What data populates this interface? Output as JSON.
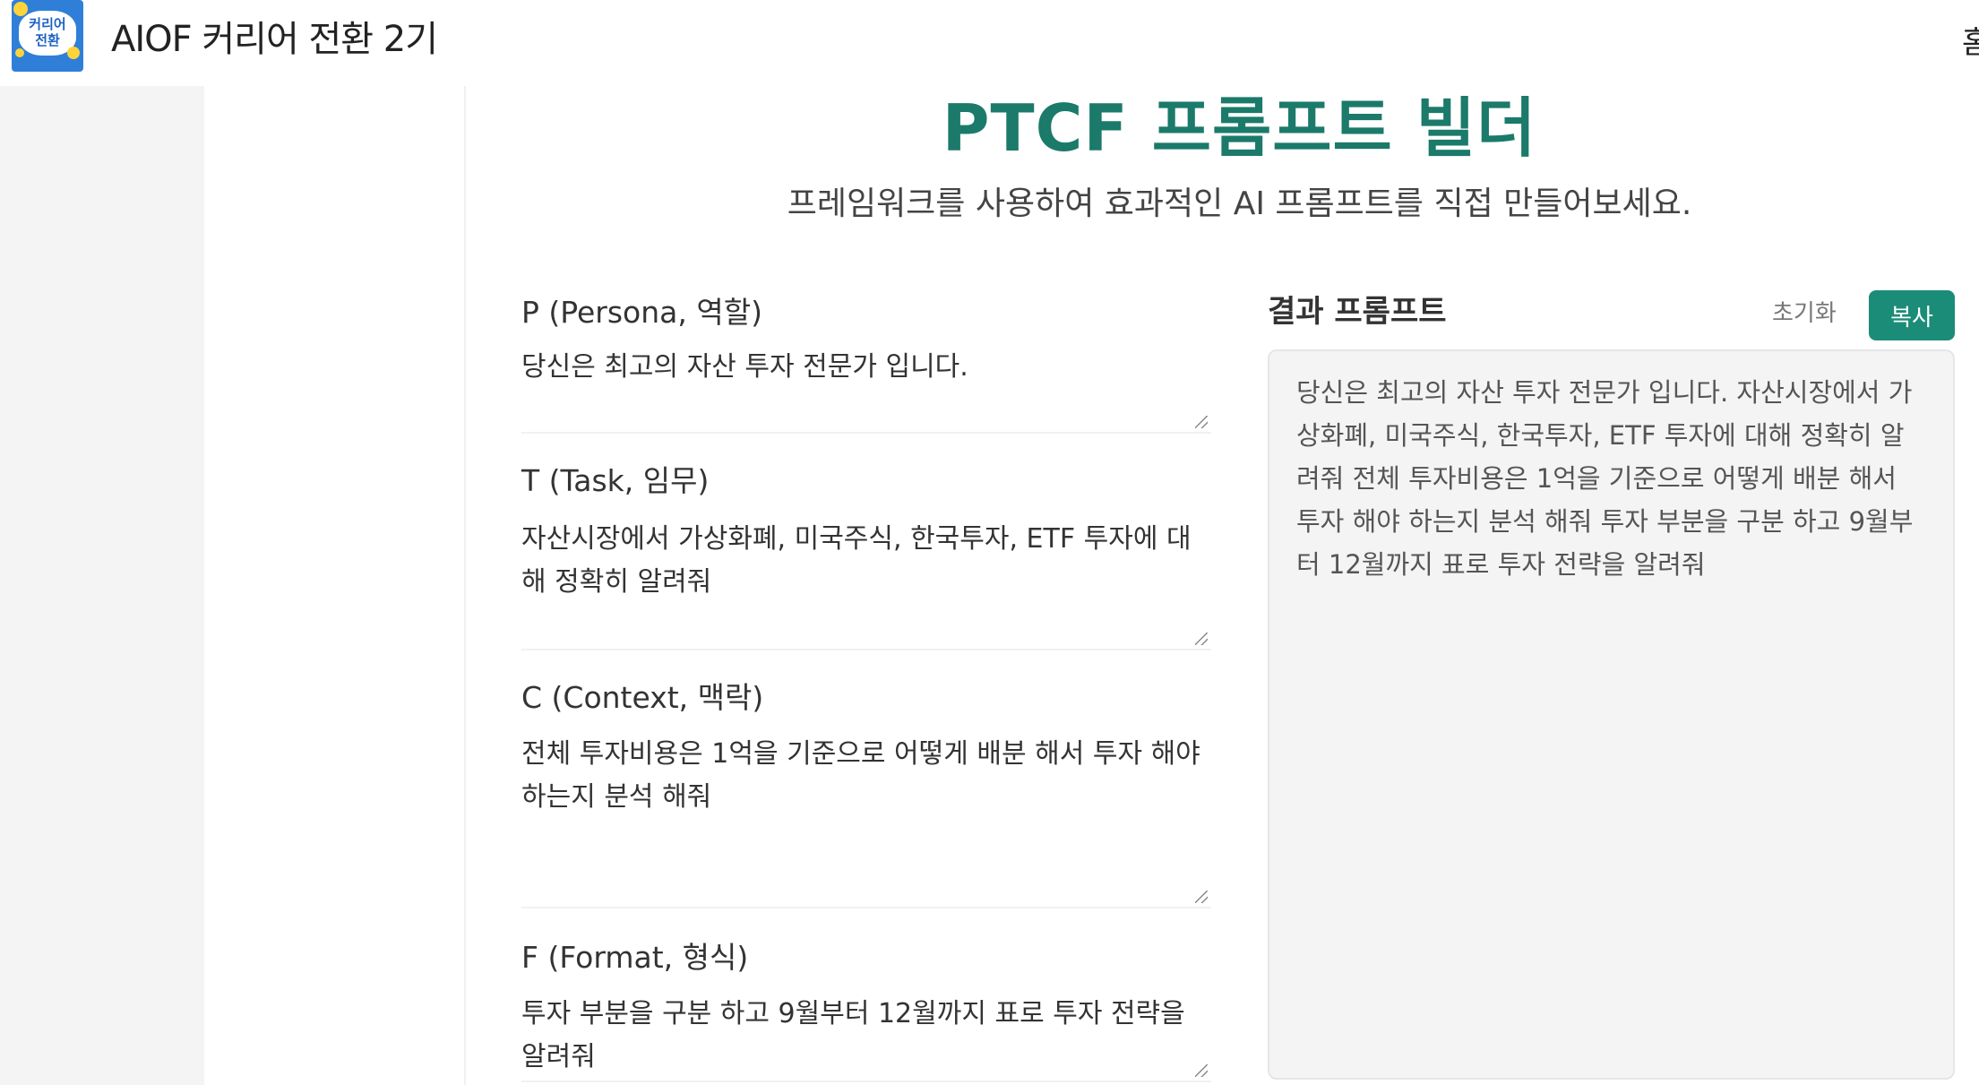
{
  "header": {
    "logo_text": "커리어\n전환",
    "site_title": "AIOF 커리어 전환 2기",
    "nav_home": "홈"
  },
  "main": {
    "title": "PTCF 프롬프트 빌더",
    "subtitle": "프레임워크를 사용하여 효과적인 AI 프롬프트를 직접 만들어보세요."
  },
  "fields": {
    "persona": {
      "label": "P (Persona, 역할)",
      "value": "당신은 최고의 자산 투자 전문가 입니다."
    },
    "task": {
      "label": "T (Task, 임무)",
      "value": "자산시장에서 가상화폐, 미국주식, 한국투자, ETF 투자에 대해 정확히 알려줘"
    },
    "context": {
      "label": "C (Context, 맥락)",
      "value": "전체 투자비용은 1억을 기준으로 어떻게 배분 해서 투자 해야 하는지 분석 해줘"
    },
    "format": {
      "label": "F (Format, 형식)",
      "value": "투자 부분을 구분 하고 9월부터 12월까지 표로 투자 전략을 알려줘"
    }
  },
  "result": {
    "title": "결과 프롬프트",
    "reset_label": "초기화",
    "copy_label": "복사",
    "text": "당신은 최고의 자산 투자 전문가 입니다. 자산시장에서 가상화폐, 미국주식, 한국투자, ETF 투자에 대해 정확히 알려줘 전체 투자비용은 1억을 기준으로 어떻게 배분 해서 투자 해야 하는지 분석 해줘 투자 부분을 구분 하고 9월부터 12월까지 표로 투자 전략을 알려줘"
  },
  "colors": {
    "accent": "#1b8c77",
    "title": "#1b7a6a",
    "logo_bg": "#2f7fd9"
  }
}
